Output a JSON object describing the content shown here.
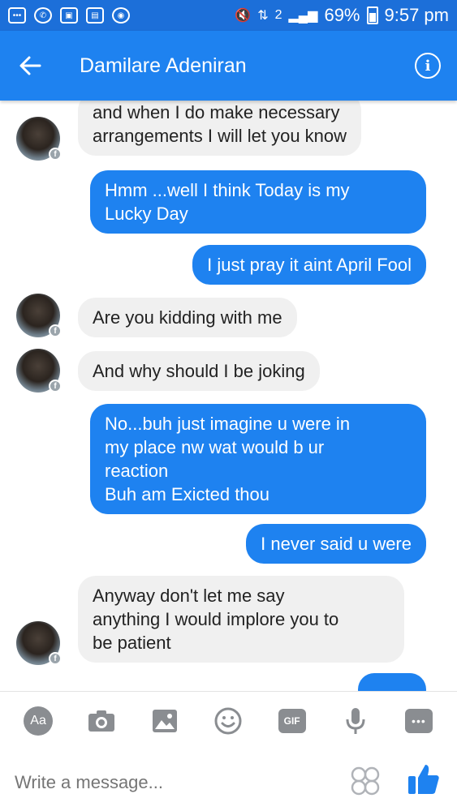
{
  "status_bar": {
    "sim_slot": "2",
    "battery": "69%",
    "time": "9:57 pm"
  },
  "app_bar": {
    "contact_name": "Damilare Adeniran"
  },
  "messages": [
    {
      "side": "in",
      "text": "and when I do make necessary\narrangements I will let you know"
    },
    {
      "side": "out",
      "text": "Hmm ...well I think Today is my\nLucky Day"
    },
    {
      "side": "out",
      "text": "I just pray it aint April Fool"
    },
    {
      "side": "in",
      "text": "Are you kidding with me"
    },
    {
      "side": "in",
      "text": "And why should I be joking"
    },
    {
      "side": "out",
      "text": "No...buh just imagine u were in\nmy place nw wat would b ur\nreaction\nBuh am Exicted thou"
    },
    {
      "side": "out",
      "text": "I never said u were"
    },
    {
      "side": "in",
      "text": "Anyway don't let me say\nanything I would implore you to\nbe patient"
    }
  ],
  "composer": {
    "aa_label": "Aa",
    "gif_label": "GIF",
    "placeholder": "Write a message..."
  },
  "colors": {
    "status_bar": "#1c6fd9",
    "app_bar": "#1e82f0",
    "outgoing_bubble": "#1e82f0",
    "incoming_bubble": "#f0f0f0"
  },
  "icons": [
    "back-arrow-icon",
    "info-icon",
    "camera-icon",
    "image-icon",
    "emoji-icon",
    "mic-icon",
    "more-icon",
    "sticker-icon",
    "like-icon"
  ]
}
